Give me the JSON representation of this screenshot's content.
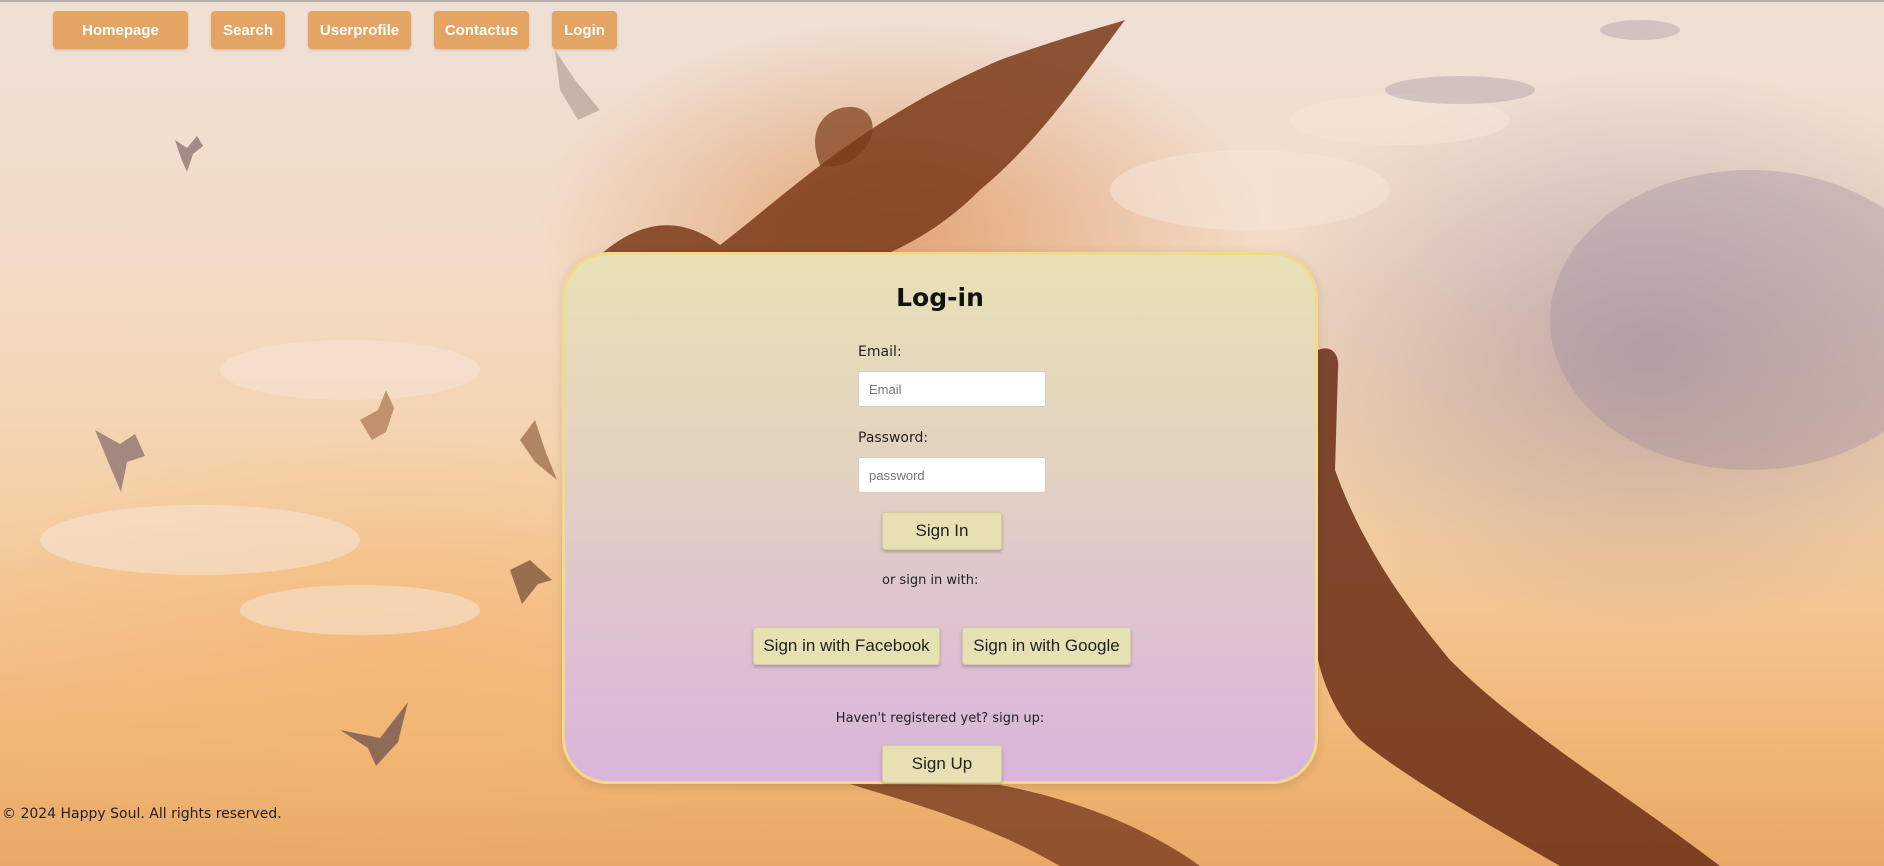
{
  "nav": {
    "items": [
      {
        "label": "Homepage"
      },
      {
        "label": "Search"
      },
      {
        "label": "Userprofile"
      },
      {
        "label": "Contactus"
      },
      {
        "label": "Login"
      }
    ]
  },
  "login": {
    "title": "Log-in",
    "email_label": "Email:",
    "email_placeholder": "Email",
    "email_value": "",
    "password_label": "Password:",
    "password_placeholder": "password",
    "password_value": "",
    "sign_in_label": "Sign In",
    "or_text": "or sign in with:",
    "facebook_label": "Sign in with Facebook",
    "google_label": "Sign in with Google",
    "register_text": "Haven't registered yet? sign up:",
    "sign_up_label": "Sign Up"
  },
  "footer": {
    "text": "© 2024 Happy Soul. All rights reserved."
  },
  "colors": {
    "nav_button": "#e4a463",
    "card_border": "#f3d98a",
    "card_top": "#e8e1b6",
    "card_bottom": "#d9b5da",
    "action_button": "#e6e0b3"
  },
  "background": {
    "icon": "sunset-sky-with-birds-image"
  }
}
